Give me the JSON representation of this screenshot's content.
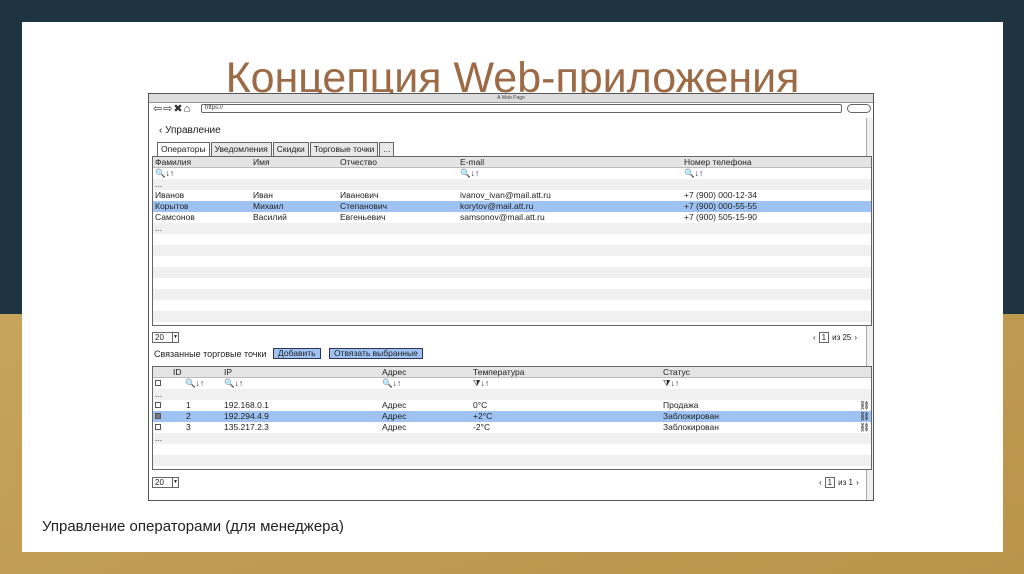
{
  "slide": {
    "title": "Концепция Web-приложения",
    "caption": "Управление операторами (для менеджера)"
  },
  "browser": {
    "title": "A Web Page",
    "nav": "⇦⇨✖⌂",
    "url": "https://"
  },
  "page": {
    "back": "‹ Управление",
    "tabs": [
      "Операторы",
      "Уведомления",
      "Скидки",
      "Торговые точки",
      "..."
    ],
    "operators": {
      "headers": [
        "Фамилия",
        "Имя",
        "Отчество",
        "E-mail",
        "Номер телефона"
      ],
      "filter_icons": [
        "🔍↓↑",
        "🔍↓↑",
        "🔍↓↑"
      ],
      "ellipsis": "...",
      "rows": [
        {
          "last": "Иванов",
          "first": "Иван",
          "middle": "Иванович",
          "email": "ivanov_ivan@mail.att.ru",
          "phone": "+7 (900) 000-12-34"
        },
        {
          "last": "Корытов",
          "first": "Михаил",
          "middle": "Степанович",
          "email": "korytov@mail.att.ru",
          "phone": "+7 (900) 000-55-55"
        },
        {
          "last": "Самсонов",
          "first": "Василий",
          "middle": "Евгеньевич",
          "email": "samsonov@mail.att.ru",
          "phone": "+7 (900) 505-15-90"
        }
      ],
      "more": "...",
      "page_size": "20",
      "current_page": "1",
      "of_pages": "из 25"
    },
    "linked": {
      "label": "Связанные торговые точки",
      "add_button": "Добавить",
      "unlink_button": "Отвязать выбранные",
      "headers": [
        "ID",
        "IP",
        "Адрес",
        "Температура",
        "Статус"
      ],
      "filter_icons": {
        "id": "🔍↓↑",
        "ip": "🔍↓↑",
        "addr": "🔍↓↑",
        "temp": "⧩↓↑",
        "status": "⧩↓↑"
      },
      "ellipsis": "...",
      "rows": [
        {
          "checked": false,
          "id": "1",
          "ip": "192.168.0.1",
          "addr": "Адрес",
          "temp": "0°C",
          "status": "Продажа"
        },
        {
          "checked": true,
          "id": "2",
          "ip": "192.294.4.9",
          "addr": "Адрес",
          "temp": "+2°C",
          "status": "Заблокирован"
        },
        {
          "checked": false,
          "id": "3",
          "ip": "135.217.2.3",
          "addr": "Адрес",
          "temp": "-2°C",
          "status": "Заблокирован"
        }
      ],
      "more": "...",
      "unlink_icon": "⛓",
      "page_size": "20",
      "current_page": "1",
      "of_pages": "из 1"
    }
  }
}
